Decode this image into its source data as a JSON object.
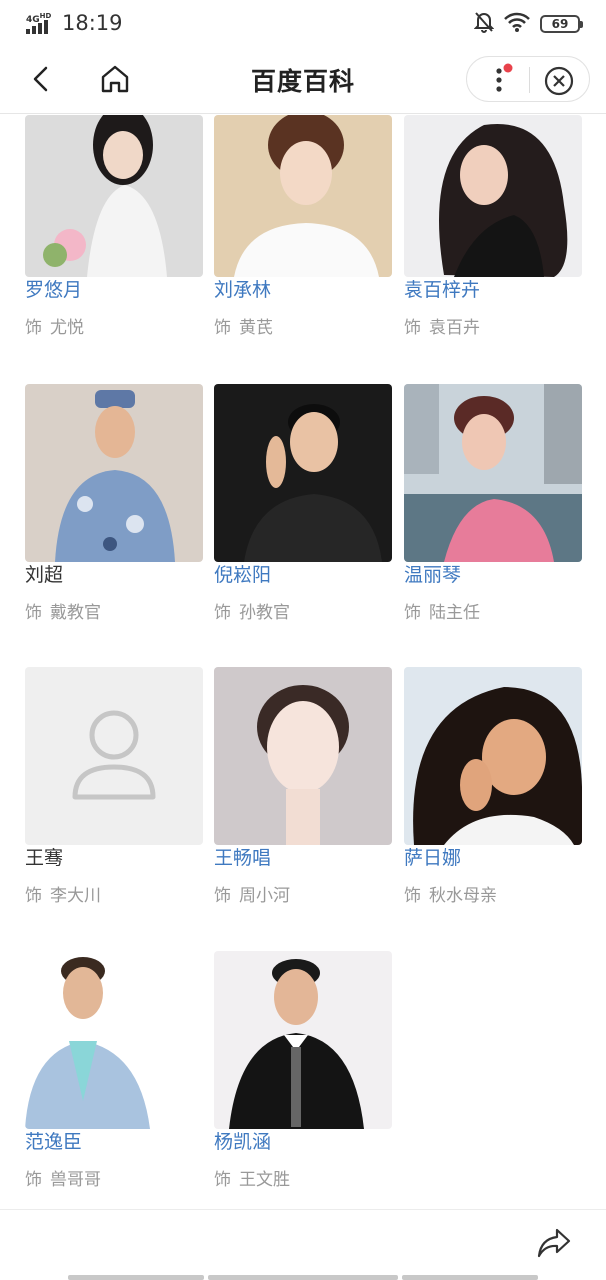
{
  "status": {
    "network": "4G",
    "network_sup": "HD",
    "time": "18:19",
    "battery": "69"
  },
  "nav": {
    "title": "百度百科"
  },
  "role_prefix": "饰",
  "cast": [
    {
      "name": "罗悠月",
      "role": "尤悦",
      "linked": true
    },
    {
      "name": "刘承林",
      "role": "黄芪",
      "linked": true
    },
    {
      "name": "袁百梓卉",
      "role": "袁百卉",
      "linked": true
    },
    {
      "name": "刘超",
      "role": "戴教官",
      "linked": false
    },
    {
      "name": "倪崧阳",
      "role": "孙教官",
      "linked": true
    },
    {
      "name": "温丽琴",
      "role": "陆主任",
      "linked": true
    },
    {
      "name": "王骞",
      "role": "李大川",
      "linked": false
    },
    {
      "name": "王畅唱",
      "role": "周小河",
      "linked": true
    },
    {
      "name": "萨日娜",
      "role": "秋水母亲",
      "linked": true
    },
    {
      "name": "范逸臣",
      "role": "兽哥哥",
      "linked": true
    },
    {
      "name": "杨凯涵",
      "role": "王文胜",
      "linked": true
    }
  ],
  "icons": {
    "back": "back-arrow-icon",
    "home": "home-icon",
    "more": "more-vertical-icon",
    "close": "close-circle-icon",
    "share": "share-icon",
    "placeholder": "person-placeholder-icon"
  },
  "colors": {
    "link": "#3f79c0",
    "muted": "#999999",
    "notify_dot": "#e8424b"
  }
}
